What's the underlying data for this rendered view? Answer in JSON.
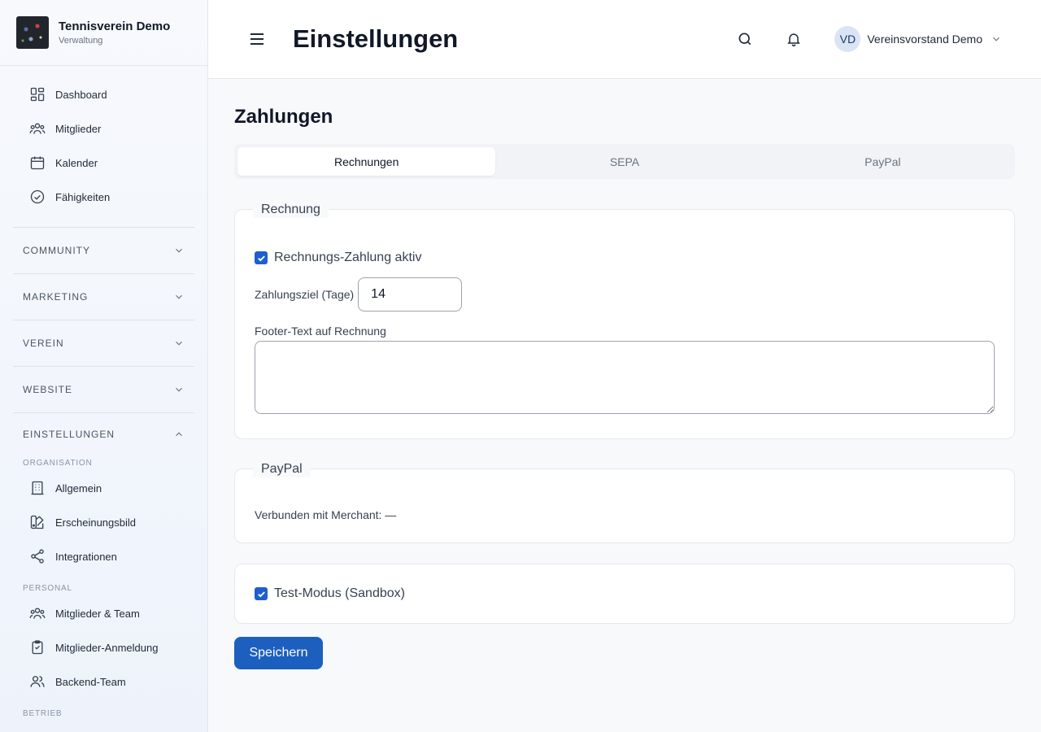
{
  "brand": {
    "name": "Tennisverein Demo",
    "subtitle": "Verwaltung"
  },
  "sidebar": {
    "top_items": [
      {
        "label": "Dashboard",
        "icon": "dashboard-icon"
      },
      {
        "label": "Mitglieder",
        "icon": "users-icon"
      },
      {
        "label": "Kalender",
        "icon": "calendar-icon"
      },
      {
        "label": "Fähigkeiten",
        "icon": "badge-check-icon"
      }
    ],
    "groups": [
      {
        "label": "COMMUNITY",
        "expanded": false
      },
      {
        "label": "MARKETING",
        "expanded": false
      },
      {
        "label": "VEREIN",
        "expanded": false
      },
      {
        "label": "WEBSITE",
        "expanded": false
      },
      {
        "label": "EINSTELLUNGEN",
        "expanded": true
      }
    ],
    "settings": {
      "organisation_heading": "ORGANISATION",
      "organisation_items": [
        {
          "label": "Allgemein",
          "icon": "building-icon"
        },
        {
          "label": "Erscheinungsbild",
          "icon": "palette-icon"
        },
        {
          "label": "Integrationen",
          "icon": "share-icon"
        }
      ],
      "personal_heading": "PERSONAL",
      "personal_items": [
        {
          "label": "Mitglieder & Team",
          "icon": "users-icon"
        },
        {
          "label": "Mitglieder-Anmeldung",
          "icon": "clipboard-icon"
        },
        {
          "label": "Backend-Team",
          "icon": "user-group-icon"
        }
      ],
      "betrieb_heading": "BETRIEB"
    }
  },
  "header": {
    "title": "Einstellungen",
    "user_initials": "VD",
    "user_name": "Vereinsvorstand Demo"
  },
  "main": {
    "section_title": "Zahlungen",
    "tabs": [
      {
        "label": "Rechnungen",
        "active": true
      },
      {
        "label": "SEPA",
        "active": false
      },
      {
        "label": "PayPal",
        "active": false
      }
    ],
    "invoice": {
      "legend": "Rechnung",
      "active_label": "Rechnungs-Zahlung aktiv",
      "active_checked": true,
      "due_label": "Zahlungsziel (Tage)",
      "due_value": "14",
      "footer_label": "Footer-Text auf Rechnung",
      "footer_value": ""
    },
    "paypal": {
      "legend": "PayPal",
      "merchant_text": "Verbunden mit Merchant: —"
    },
    "sandbox": {
      "label": "Test-Modus (Sandbox)",
      "checked": true
    },
    "save_label": "Speichern"
  },
  "colors": {
    "accent": "#1d5fbf",
    "checkbox": "#1d5fd1"
  }
}
